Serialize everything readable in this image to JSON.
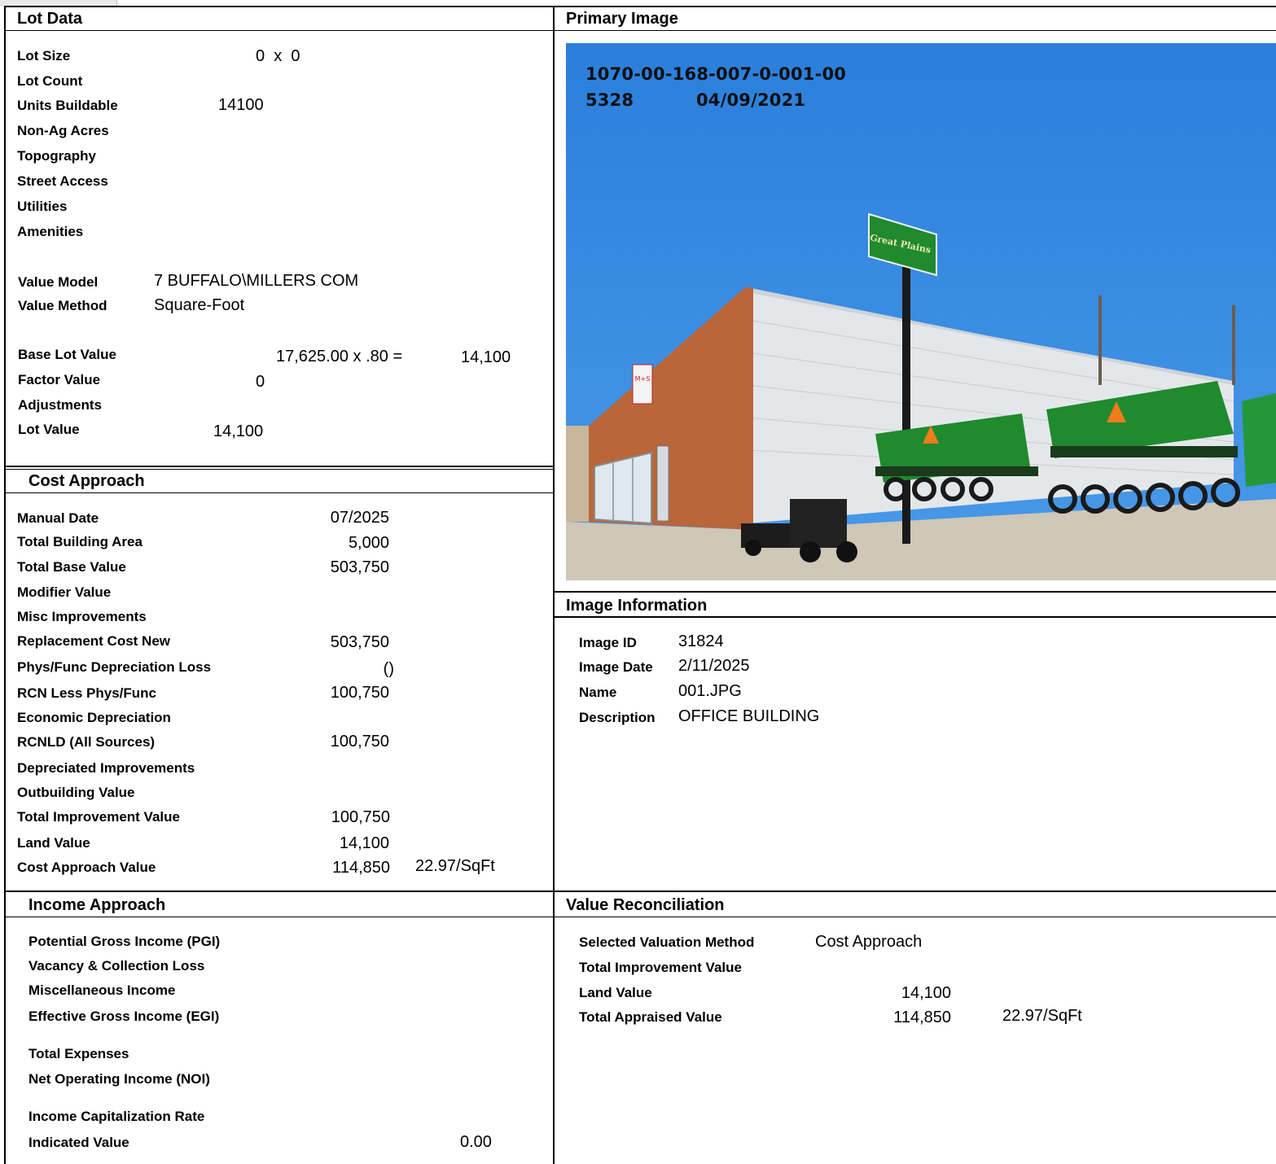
{
  "lot_data": {
    "header": "Lot Data",
    "rows": [
      {
        "label": "Lot Size",
        "value": "0  x  0"
      },
      {
        "label": "Lot Count",
        "value": ""
      },
      {
        "label": "Units Buildable",
        "value": "14100"
      },
      {
        "label": "Non-Ag Acres",
        "value": ""
      },
      {
        "label": "Topography",
        "value": ""
      },
      {
        "label": "Street Access",
        "value": ""
      },
      {
        "label": "Utilities",
        "value": ""
      },
      {
        "label": "Amenities",
        "value": ""
      }
    ],
    "value_model_label": "Value Model",
    "value_model": "7 BUFFALO\\MILLERS COM",
    "value_method_label": "Value Method",
    "value_method": "Square-Foot",
    "base_lot_value_label": "Base Lot Value",
    "base_lot_calc": "17,625.00 x .80 =",
    "base_lot_value": "14,100",
    "factor_value_label": "Factor Value",
    "factor_value": "0",
    "adjustments_label": "Adjustments",
    "lot_value_label": "Lot Value",
    "lot_value": "14,100"
  },
  "cost_approach": {
    "header": "Cost Approach",
    "rows": [
      {
        "label": "Manual Date",
        "value": "07/2025"
      },
      {
        "label": "Total Building Area",
        "value": "5,000"
      },
      {
        "label": "Total Base Value",
        "value": "503,750"
      },
      {
        "label": "Modifier Value",
        "value": ""
      },
      {
        "label": "Misc Improvements",
        "value": ""
      },
      {
        "label": "Replacement Cost New",
        "value": "503,750"
      },
      {
        "label": "Phys/Func Depreciation Loss",
        "value": "()"
      },
      {
        "label": "RCN Less Phys/Func",
        "value": "100,750"
      },
      {
        "label": "Economic Depreciation",
        "value": ""
      },
      {
        "label": "RCNLD (All Sources)",
        "value": "100,750"
      },
      {
        "label": "Depreciated Improvements",
        "value": ""
      },
      {
        "label": "Outbuilding Value",
        "value": ""
      },
      {
        "label": "Total Improvement Value",
        "value": "100,750"
      },
      {
        "label": "Land Value",
        "value": "14,100"
      },
      {
        "label": "Cost Approach Value",
        "value": "114,850"
      }
    ],
    "per_sqft": "22.97/SqFt"
  },
  "income_approach": {
    "header": "Income Approach",
    "rows": [
      {
        "label": "Potential Gross Income (PGI)"
      },
      {
        "label": "Vacancy & Collection Loss"
      },
      {
        "label": "Miscellaneous Income"
      },
      {
        "label": "Effective Gross Income (EGI)"
      },
      {
        "label": "Total Expenses"
      },
      {
        "label": "Net Operating Income (NOI)"
      },
      {
        "label": "Income Capitalization Rate"
      },
      {
        "label": "Indicated Value"
      }
    ],
    "indicated_value": "0.00"
  },
  "primary_image": {
    "header": "Primary Image",
    "caption_parcel": "1070-00-168-007-0-001-00",
    "caption_id": "5328",
    "caption_date": "04/09/2021",
    "sign_text": "Great Plains",
    "window_sign": "M+S"
  },
  "image_information": {
    "header": "Image Information",
    "rows": [
      {
        "label": "Image ID",
        "value": "31824"
      },
      {
        "label": "Image Date",
        "value": "2/11/2025"
      },
      {
        "label": "Name",
        "value": "001.JPG"
      },
      {
        "label": "Description",
        "value": "OFFICE BUILDING"
      }
    ]
  },
  "value_reconciliation": {
    "header": "Value Reconciliation",
    "selected_method_label": "Selected Valuation Method",
    "selected_method": "Cost Approach",
    "total_improvement_label": "Total Improvement Value",
    "land_value_label": "Land Value",
    "land_value": "14,100",
    "total_appraised_label": "Total Appraised Value",
    "total_appraised": "114,850",
    "per_sqft": "22.97/SqFt"
  },
  "colors": {
    "sky": "#2f86e0",
    "brick": "#b9663a",
    "equipment_green": "#1f8a2e"
  }
}
